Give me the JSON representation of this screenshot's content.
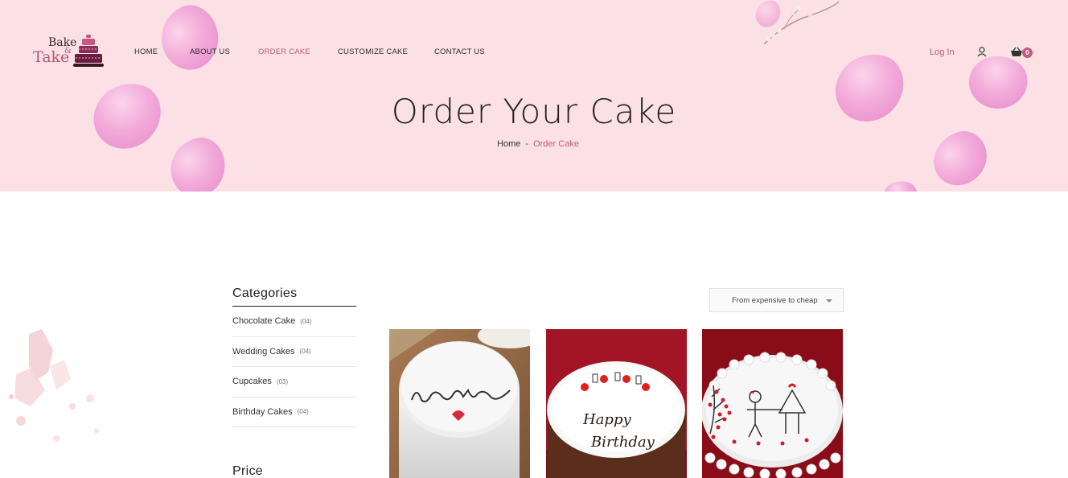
{
  "brand": {
    "line1": "Bake",
    "amp": "&",
    "line2": "Take"
  },
  "nav": {
    "home": "HOME",
    "about": "ABOUT US",
    "order": "ORDER CAKE",
    "customize": "CUSTOMIZE CAKE",
    "contact": "CONTACT US"
  },
  "header": {
    "login": "Log In",
    "cart_count": "0"
  },
  "hero": {
    "title": "Order Your Cake",
    "breadcrumb_home": "Home",
    "breadcrumb_sep": "-",
    "breadcrumb_current": "Order Cake"
  },
  "sidebar": {
    "categories_title": "Categories",
    "categories": [
      {
        "name": "Chocolate Cake",
        "count": "(04)"
      },
      {
        "name": "Wedding Cakes",
        "count": "(04)"
      },
      {
        "name": "Cupcakes",
        "count": "(03)"
      },
      {
        "name": "Birthday Cakes",
        "count": "(04)"
      }
    ],
    "price_title": "Price"
  },
  "sort": {
    "selected": "From expensive to cheap"
  },
  "products": [
    {
      "image": "love-cake",
      "cake_text": "Love"
    },
    {
      "image": "happy-birthday-cake",
      "cake_text_line1": "Happy",
      "cake_text_line2": "Birthday"
    },
    {
      "image": "couple-drawing-cake"
    }
  ],
  "colors": {
    "accent": "#c25a84",
    "hero_bg": "#fbe1e6",
    "text": "#222222"
  }
}
